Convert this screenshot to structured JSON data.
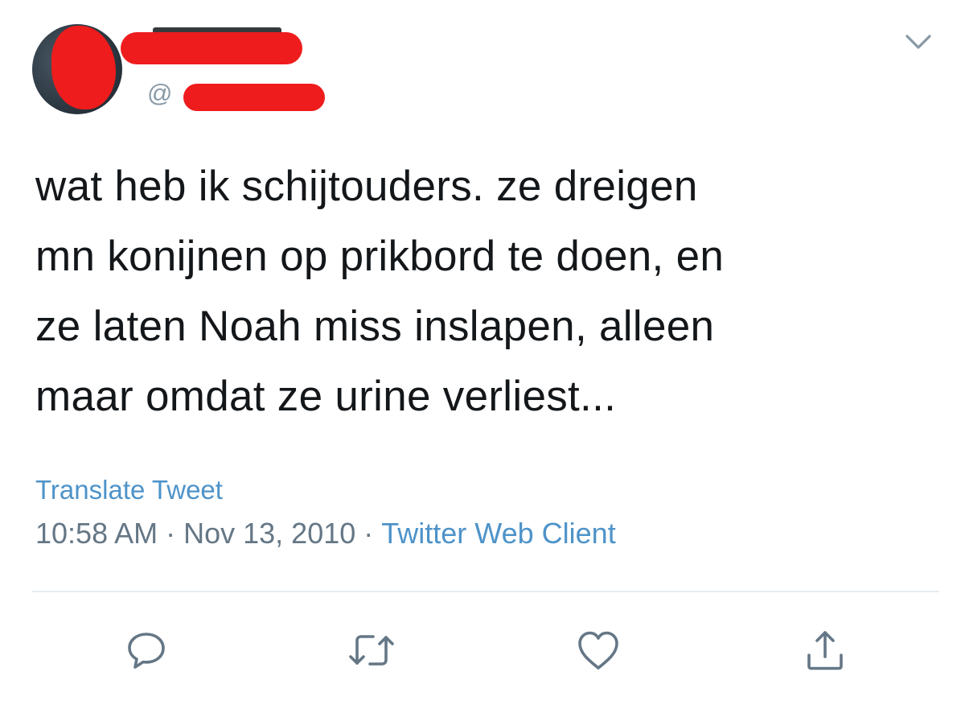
{
  "author": {
    "handle_prefix": "@",
    "avatar": "avatar-redacted"
  },
  "tweet": {
    "lines": [
      "wat heb ik schijtouders. ze dreigen",
      "mn konijnen op prikbord te doen, en",
      "ze laten Noah miss inslapen, alleen",
      "maar omdat ze urine verliest..."
    ],
    "translate_label": "Translate Tweet",
    "time": "10:58 AM",
    "separator": "·",
    "date": "Nov 13, 2010",
    "client": "Twitter Web Client"
  },
  "actions": {
    "reply_icon": "reply-icon",
    "retweet_icon": "retweet-icon",
    "like_icon": "heart-icon",
    "share_icon": "share-icon",
    "menu_icon": "chevron-down-icon"
  },
  "colors": {
    "text": "#14171a",
    "secondary": "#657786",
    "link": "#4e93c9",
    "icon": "#657786",
    "divider": "#e6ecf0",
    "redaction": "#ee1c1c"
  }
}
